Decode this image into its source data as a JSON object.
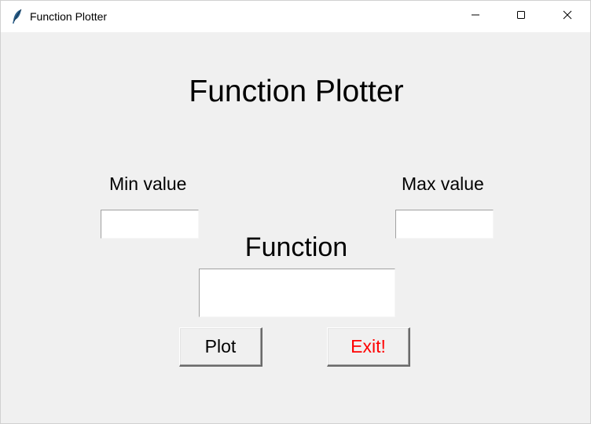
{
  "window": {
    "title": "Function Plotter",
    "icon": "feather-icon",
    "controls": [
      "minimize-icon",
      "maximize-icon",
      "close-icon"
    ]
  },
  "main": {
    "heading": "Function Plotter",
    "min_label": "Min value",
    "min_value": "",
    "max_label": "Max value",
    "max_value": "",
    "function_label": "Function",
    "function_value": "",
    "plot_button": "Plot",
    "exit_button": "Exit!"
  },
  "colors": {
    "exit_text": "#ff0000",
    "background": "#f0f0f0"
  }
}
